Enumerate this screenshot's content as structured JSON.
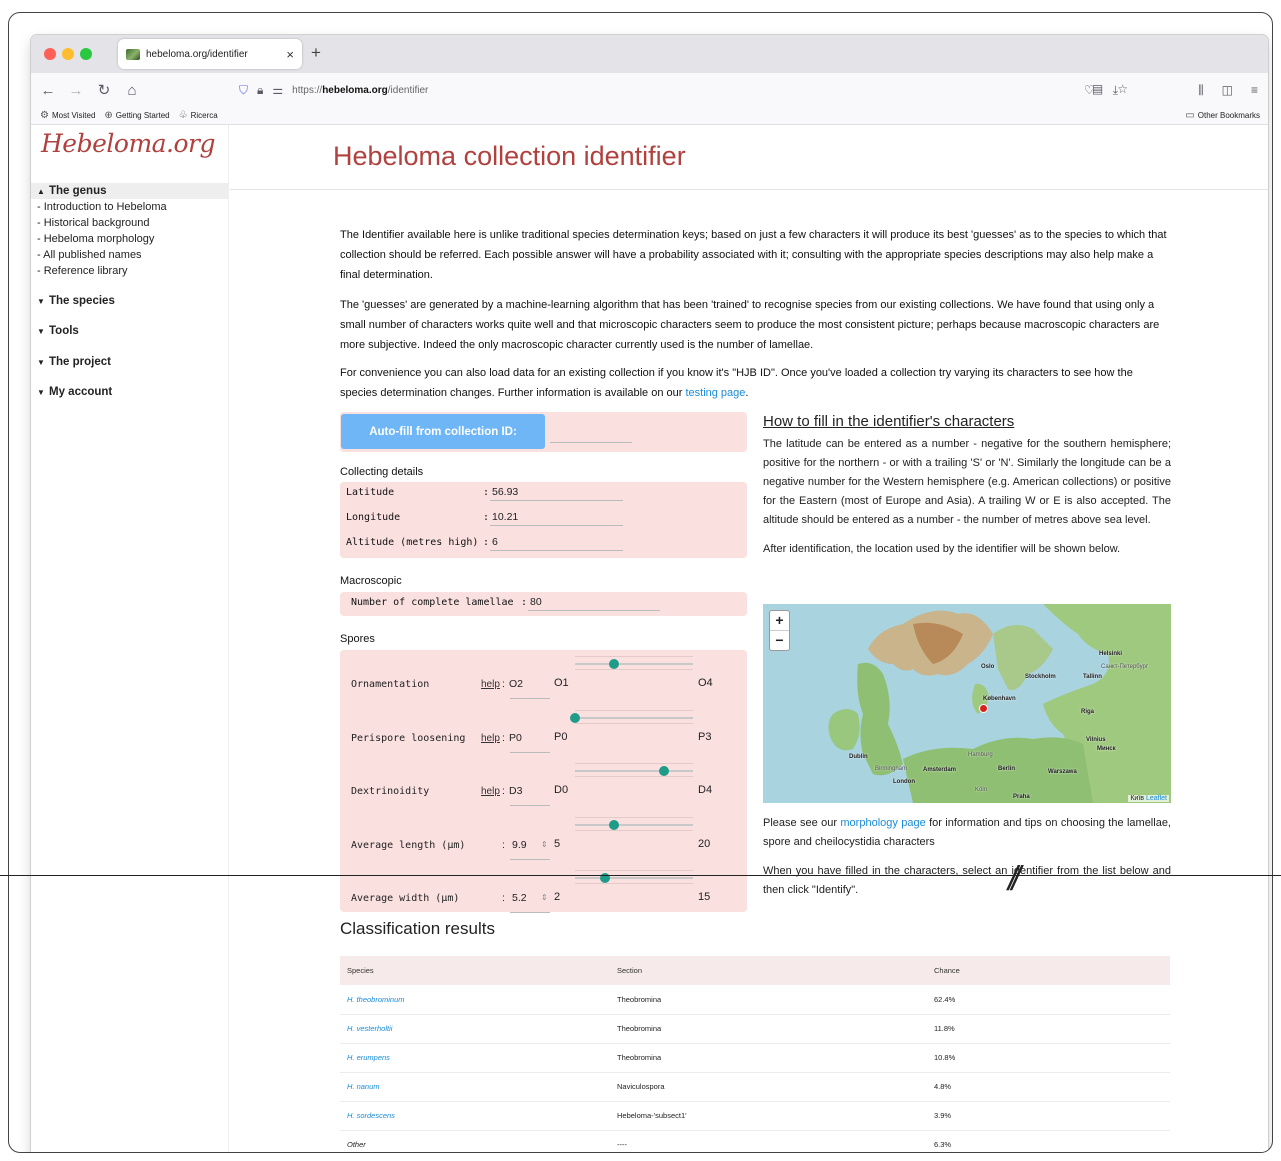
{
  "browser": {
    "tab_title": "hebeloma.org/identifier",
    "new_tab": "+",
    "url_prefix": "https://",
    "url_host": "hebeloma.org",
    "url_path": "/identifier",
    "bookmarks": [
      "Most Visited",
      "Getting Started",
      "Ricerca"
    ],
    "other_bookmarks": "Other Bookmarks"
  },
  "sidebar": {
    "logo": "Hebeloma.org",
    "sections": [
      {
        "label": "The genus",
        "items": [
          "- Introduction to Hebeloma",
          "- Historical background",
          "- Hebeloma morphology",
          "- All published names",
          "- Reference library"
        ]
      },
      {
        "label": "The species"
      },
      {
        "label": "Tools"
      },
      {
        "label": "The project"
      },
      {
        "label": "My account"
      }
    ]
  },
  "page": {
    "title": "Hebeloma collection identifier",
    "para1": "The Identifier available here is unlike traditional species determination keys; based on just a few characters it will produce its best 'guesses' as to the species to which that collection should be referred. Each possible answer will have a probability associated with it; consulting with the appropriate species descriptions may also help make a final determination.",
    "para2": "The 'guesses' are generated by a machine-learning algorithm that has been 'trained' to recognise species from our existing collections. We have found that using only a small number of characters works quite well and that microscopic characters seem to produce the most consistent picture; perhaps because macroscopic characters are more subjective. Indeed the only macroscopic character currently used is the number of lamellae.",
    "para3_pre": "For convenience you can also load data for an existing collection if you know it's \"HJB ID\". Once you've loaded a collection try varying its characters to see how the species determination changes. Further information is available on our ",
    "para3_link": "testing page",
    "para3_post": "."
  },
  "form": {
    "autofill_label": "Auto-fill from collection ID:",
    "collecting_label": "Collecting details",
    "latitude_label": "Latitude",
    "latitude_value": "56.93",
    "longitude_label": "Longitude",
    "longitude_value": "10.21",
    "altitude_label": "Altitude (metres high)",
    "altitude_value": "6",
    "macro_label": "Macroscopic",
    "lamellae_label": "Number of complete lamellae",
    "lamellae_value": "80",
    "spores_label": "Spores",
    "help": "help",
    "colon": ":",
    "spores": [
      {
        "label": "Ornamentation",
        "value": "O2",
        "min": "O1",
        "max": "O4",
        "level": 0.33
      },
      {
        "label": "Perispore loosening",
        "value": "P0",
        "min": "P0",
        "max": "P3",
        "level": 0.0
      },
      {
        "label": "Dextrinoidity",
        "value": "D3",
        "min": "D0",
        "max": "D4",
        "level": 0.75
      },
      {
        "label": "Average length (µm)",
        "value": "9.9",
        "min": "5",
        "max": "20",
        "level": 0.33
      },
      {
        "label": "Average width (µm)",
        "value": "5.2",
        "min": "2",
        "max": "15",
        "level": 0.25
      }
    ]
  },
  "help_panel": {
    "heading": "How to fill in the identifier's characters",
    "p1": "The latitude can be entered as a number - negative for the southern hemisphere; positive for the northern - or with a trailing 'S' or 'N'. Similarly the longitude can be a negative number for the Western hemisphere (e.g. American collections) or positive for the Eastern (most of Europe and Asia). A trailing W or E is also accepted. The altitude should be entered as a number - the number of metres above sea level.",
    "p2": "After identification, the location used by the identifier will be shown below.",
    "p3_pre": "Please see our ",
    "p3_link": "morphology page",
    "p3_post": " for information and tips on choosing the lamellae, spore and cheilocystidia characters",
    "p4": "When you have filled in the characters, select an identifier from the list below and then click \"Identify\"."
  },
  "map": {
    "zoom_in": "+",
    "zoom_out": "−",
    "labels": [
      "Helsinki",
      "Санкт-Петербург",
      "Oslo",
      "Stockholm",
      "Tallinn",
      "Riga",
      "København",
      "Vilnius",
      "Минск",
      "Dublin",
      "Birmingham",
      "Hamburg",
      "Amsterdam",
      "Berlin",
      "Warszawa",
      "London",
      "Köln",
      "Praha"
    ],
    "kyiv": "Київ",
    "attribution": "Leaflet"
  },
  "results": {
    "title": "Classification results",
    "columns": [
      "Species",
      "Section",
      "Chance"
    ],
    "rows": [
      {
        "species": "H. theobrominum",
        "section": "Theobromina",
        "chance": "62.4%"
      },
      {
        "species": "H. vesterholtii",
        "section": "Theobromina",
        "chance": "11.8%"
      },
      {
        "species": "H. erumpens",
        "section": "Theobromina",
        "chance": "10.8%"
      },
      {
        "species": "H. nanum",
        "section": "Naviculospora",
        "chance": "4.8%"
      },
      {
        "species": "H. sordescens",
        "section": "Hebeloma-'subsect1'",
        "chance": "3.9%"
      },
      {
        "species": "Other",
        "section": "----",
        "chance": "6.3%"
      }
    ]
  },
  "colors": {
    "accent": "#b0413e",
    "link": "#1a8bd8",
    "panel": "#fbe0e0",
    "button": "#6eb6f6",
    "slider": "#1f9b8a"
  }
}
